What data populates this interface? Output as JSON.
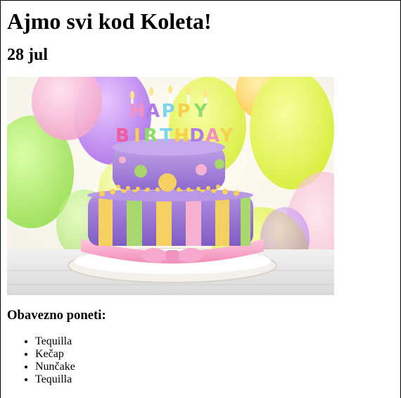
{
  "page": {
    "title": "Ajmo svi kod Koleta!",
    "date": "28 jul",
    "image": {
      "banner_text": "HAPPY BIRTHDAY"
    },
    "bring_heading": "Obavezno poneti:",
    "bring_items": [
      "Tequilla",
      "Kečap",
      "Nunčake",
      "Tequilla"
    ]
  }
}
